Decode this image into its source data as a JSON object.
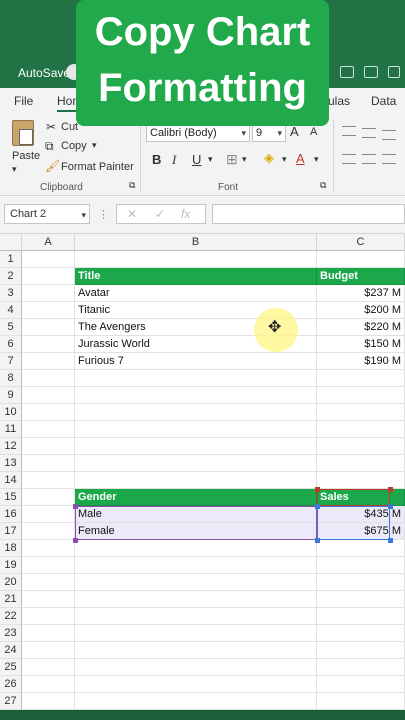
{
  "overlay": {
    "line1": "Copy Chart",
    "line2": "Formatting"
  },
  "titlebar": {
    "autosave": "AutoSave"
  },
  "tabs": {
    "file": "File",
    "home": "Hom",
    "formulas": "ulas",
    "data": "Data"
  },
  "clipboard": {
    "paste": "Paste",
    "cut": "Cut",
    "copy": "Copy",
    "format_painter": "Format Painter",
    "group_label": "Clipboard"
  },
  "font": {
    "name": "Calibri (Body)",
    "size": "9",
    "bold": "B",
    "italic": "I",
    "underline": "U",
    "grow": "A",
    "shrink": "A",
    "group_label": "Font"
  },
  "namebox": {
    "value": "Chart 2"
  },
  "columns": [
    "A",
    "B",
    "C"
  ],
  "rows": [
    "1",
    "2",
    "3",
    "4",
    "5",
    "6",
    "7",
    "8",
    "9",
    "10",
    "11",
    "12",
    "13",
    "14",
    "15",
    "16",
    "17",
    "18",
    "19",
    "20",
    "21",
    "22",
    "23",
    "24",
    "25",
    "26",
    "27"
  ],
  "table1": {
    "headers": [
      "Title",
      "Budget"
    ],
    "rows": [
      [
        "Avatar",
        "$237 M"
      ],
      [
        "Titanic",
        "$200 M"
      ],
      [
        "The Avengers",
        "$220 M"
      ],
      [
        "Jurassic World",
        "$150 M"
      ],
      [
        "Furious 7",
        "$190 M"
      ]
    ]
  },
  "table2": {
    "headers": [
      "Gender",
      "Sales"
    ],
    "rows": [
      [
        "Male",
        "$435 M"
      ],
      [
        "Female",
        "$675 M"
      ]
    ]
  },
  "colors": {
    "excel_green": "#217346",
    "header_green": "#1aa84b",
    "overlay_green": "#22a94b",
    "range_purple": "#8a4fb0",
    "range_blue": "#3b78d8",
    "range_red": "#c0392b"
  }
}
